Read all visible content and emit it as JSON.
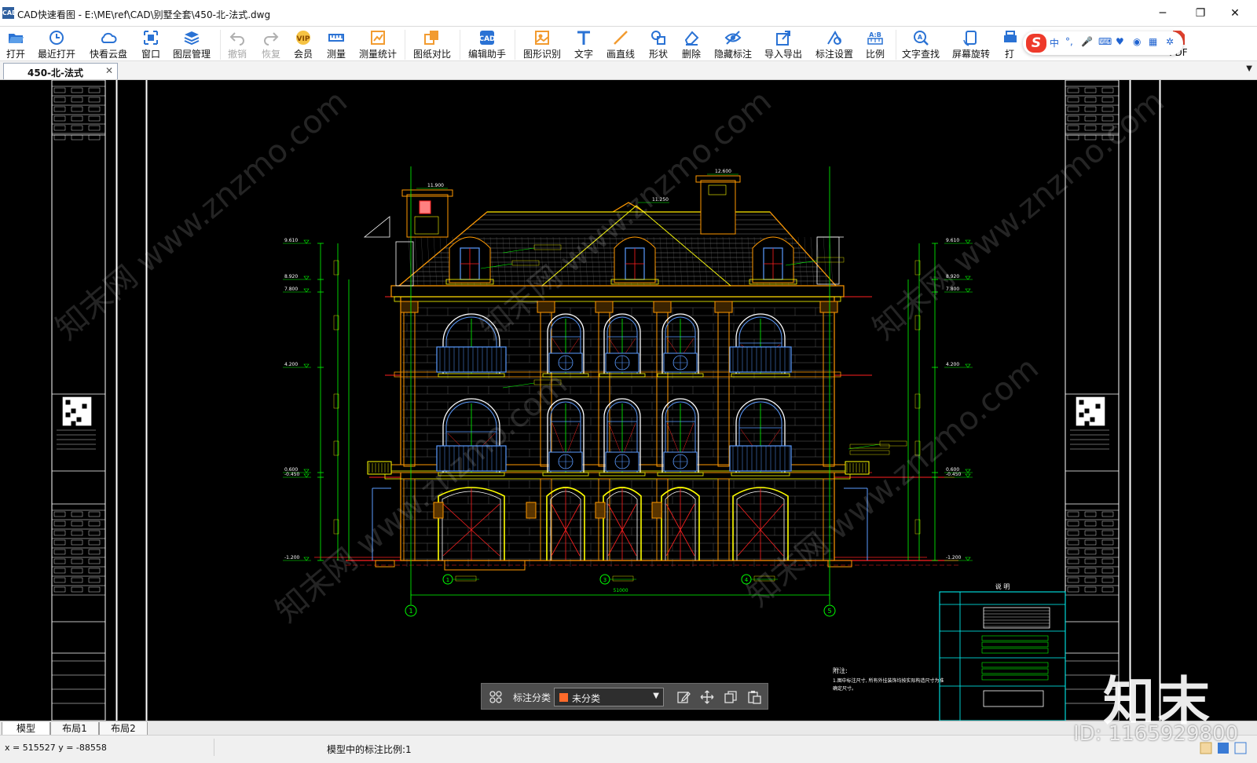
{
  "window": {
    "app_name": "CAD快速看图",
    "title": "CAD快速看图 - E:\\ME\\ref\\CAD\\别墅全套\\450-北-法式.dwg",
    "min_glyph": "─",
    "max_glyph": "❐",
    "close_glyph": "✕"
  },
  "toolbar": {
    "items": [
      {
        "label": "打开",
        "icon": "folder-open-icon",
        "enabled": true
      },
      {
        "label": "最近打开",
        "icon": "clock-icon",
        "enabled": true
      },
      {
        "label": "快看云盘",
        "icon": "cloud-icon",
        "enabled": true
      },
      {
        "label": "窗口",
        "icon": "window-icon",
        "enabled": true
      },
      {
        "label": "图层管理",
        "icon": "layers-icon",
        "enabled": true
      },
      {
        "label": "撤销",
        "icon": "undo-icon",
        "enabled": false
      },
      {
        "label": "恢复",
        "icon": "redo-icon",
        "enabled": false
      },
      {
        "label": "会员",
        "icon": "vip-icon",
        "enabled": true
      },
      {
        "label": "测量",
        "icon": "measure-icon",
        "enabled": true
      },
      {
        "label": "测量统计",
        "icon": "measure-stats-icon",
        "enabled": true
      },
      {
        "label": "图纸对比",
        "icon": "compare-icon",
        "enabled": true
      },
      {
        "label": "编辑助手",
        "icon": "edit-assistant-icon",
        "enabled": true
      },
      {
        "label": "图形识别",
        "icon": "shape-recognize-icon",
        "enabled": true
      },
      {
        "label": "文字",
        "icon": "text-icon",
        "enabled": true
      },
      {
        "label": "画直线",
        "icon": "line-icon",
        "enabled": true
      },
      {
        "label": "形状",
        "icon": "shape-icon",
        "enabled": true
      },
      {
        "label": "删除",
        "icon": "eraser-icon",
        "enabled": true
      },
      {
        "label": "隐藏标注",
        "icon": "eye-hide-icon",
        "enabled": true
      },
      {
        "label": "导入导出",
        "icon": "import-export-icon",
        "enabled": true
      },
      {
        "label": "标注设置",
        "icon": "annotation-settings-icon",
        "enabled": true
      },
      {
        "label": "比例",
        "icon": "scale-icon",
        "enabled": true
      },
      {
        "label": "文字查找",
        "icon": "text-search-icon",
        "enabled": true
      },
      {
        "label": "屏幕旋转",
        "icon": "rotate-screen-icon",
        "enabled": true
      },
      {
        "label": "打",
        "icon": "print-icon",
        "enabled": true
      },
      {
        "label": "PDF",
        "icon": "pdf-icon",
        "enabled": true
      }
    ]
  },
  "ime": {
    "mode": "中",
    "punct": "°,",
    "logo": "S"
  },
  "tabs": {
    "active_doc": "450-北-法式",
    "close_glyph": "✕",
    "dropdown_glyph": "▼"
  },
  "annotation_bar": {
    "label": "标注分类",
    "category": "未分类",
    "swatch_color": "#ff6a2a"
  },
  "layout_tabs": [
    "模型",
    "布局1",
    "布局2"
  ],
  "status": {
    "coords": "x = 515527  y = -88558",
    "scale_text": "模型中的标注比例:1"
  },
  "watermark": {
    "brand": "知末",
    "id_text": "ID: 1165929800",
    "site": "知末网 www.znzmo.com"
  },
  "drawing": {
    "background": "#000000",
    "dims": {
      "overall_width": "51000",
      "elev_left": [
        "9.610",
        "8.920",
        "7.800",
        "4.200",
        "0.600",
        "-0.450",
        "-1.200"
      ],
      "elev_right": [
        "9.610",
        "8.920",
        "7.800",
        "4.200",
        "0.600",
        "-0.450",
        "-1.200"
      ],
      "top_mark": "12.600",
      "left_chimney_mark": "11.900",
      "ridge_mark": "11.250"
    },
    "axes": [
      "1",
      "5"
    ],
    "grid_marks": [
      "1",
      "3",
      "4"
    ],
    "notes": [
      "附注:",
      "1.图中标注尺寸, 所有外挂装饰均按实际构造尺寸为准",
      "确定尺寸。"
    ],
    "table_title": "说 明",
    "accent": {
      "green": "#00ff00",
      "yellow": "#ffff00",
      "orange": "#ff9900",
      "cyan": "#00ffff",
      "red": "#ff2020",
      "blue": "#5b9bff",
      "white": "#ffffff"
    }
  }
}
